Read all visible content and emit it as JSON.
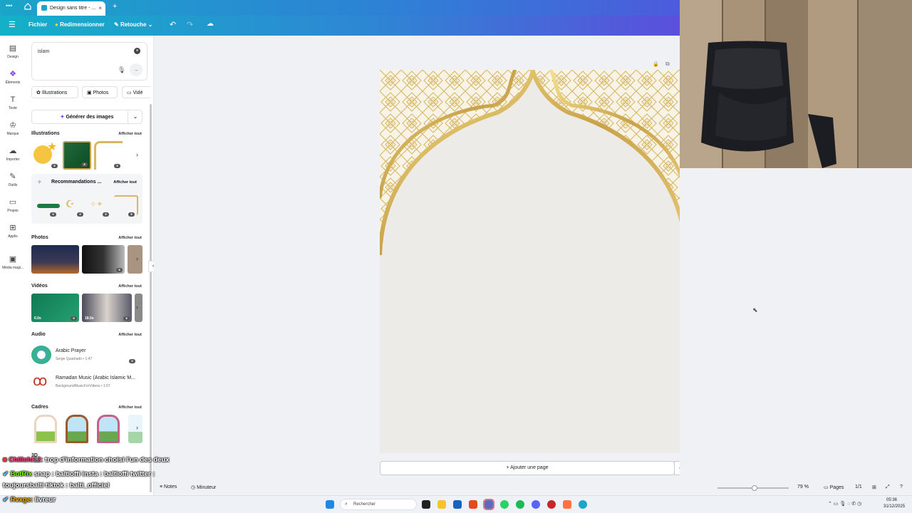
{
  "browser": {
    "tab_title": "Design sans titre - ...",
    "new_tab": "+",
    "menu_dots": "•••"
  },
  "topbar": {
    "file": "Fichier",
    "resize": "Redimensionner",
    "retouch": "Retouche"
  },
  "rail": [
    {
      "label": "Design",
      "icon": "layout-icon"
    },
    {
      "label": "Éléments",
      "icon": "elements-icon"
    },
    {
      "label": "Texte",
      "icon": "text-icon"
    },
    {
      "label": "Marque",
      "icon": "brand-icon"
    },
    {
      "label": "Importer",
      "icon": "upload-icon"
    },
    {
      "label": "Outils",
      "icon": "tools-icon"
    },
    {
      "label": "Projets",
      "icon": "folder-icon"
    },
    {
      "label": "Applis",
      "icon": "apps-icon"
    },
    {
      "label": "Média magi...",
      "icon": "magic-media-icon"
    }
  ],
  "search": {
    "value": "islam"
  },
  "filters": {
    "illustrations": "Illustrations",
    "photos": "Photos",
    "videos": "Vidé"
  },
  "generate": {
    "label": "Générer des images"
  },
  "sections": {
    "illustrations": {
      "title": "Illustrations",
      "link": "Afficher tout"
    },
    "recommendations": {
      "title": "Recommandations ...",
      "link": "Afficher tout"
    },
    "photos": {
      "title": "Photos",
      "link": "Afficher tout"
    },
    "videos": {
      "title": "Vidéos",
      "link": "Afficher tout"
    },
    "audio": {
      "title": "Audio",
      "link": "Afficher tout"
    },
    "frames": {
      "title": "Cadres",
      "link": "Afficher tout"
    },
    "threed": {
      "title": "3D"
    }
  },
  "videos": [
    {
      "duration": "6.0s"
    },
    {
      "duration": "18.0s"
    }
  ],
  "audio": [
    {
      "title": "Arabic Prayer",
      "meta": "Serge Quadrado • 1:47"
    },
    {
      "title": "Ramadan Music (Arabic Islamic M...",
      "meta": "BackgroundMusicForVideos • 1:07"
    }
  ],
  "canvas": {
    "add_page": "+ Ajouter une page"
  },
  "status": {
    "notes": "Notes",
    "timer": "Minuteur",
    "zoom": "79 %",
    "pages": "Pages",
    "page_count": "1/1"
  },
  "taskbar": {
    "search": "Rechercher",
    "time": "05:36",
    "date": "31/12/2025"
  },
  "chat": [
    {
      "user": "Chilichi12:",
      "text": "trop d'information choisi l'un des deux"
    },
    {
      "user": "BotRix",
      "text": "snap : baltioffi insta : baltioffi twitter :"
    },
    {
      "user": "",
      "text": "toujoursbalti tiktok : balti_officiel"
    },
    {
      "user": "Rvxge:",
      "text": "livreur"
    }
  ],
  "colors": {
    "accent_teal": "#14b0c8",
    "accent_purple": "#5b4fdc",
    "gold": "#c9a24a",
    "page_bg": "#ecebe8"
  }
}
